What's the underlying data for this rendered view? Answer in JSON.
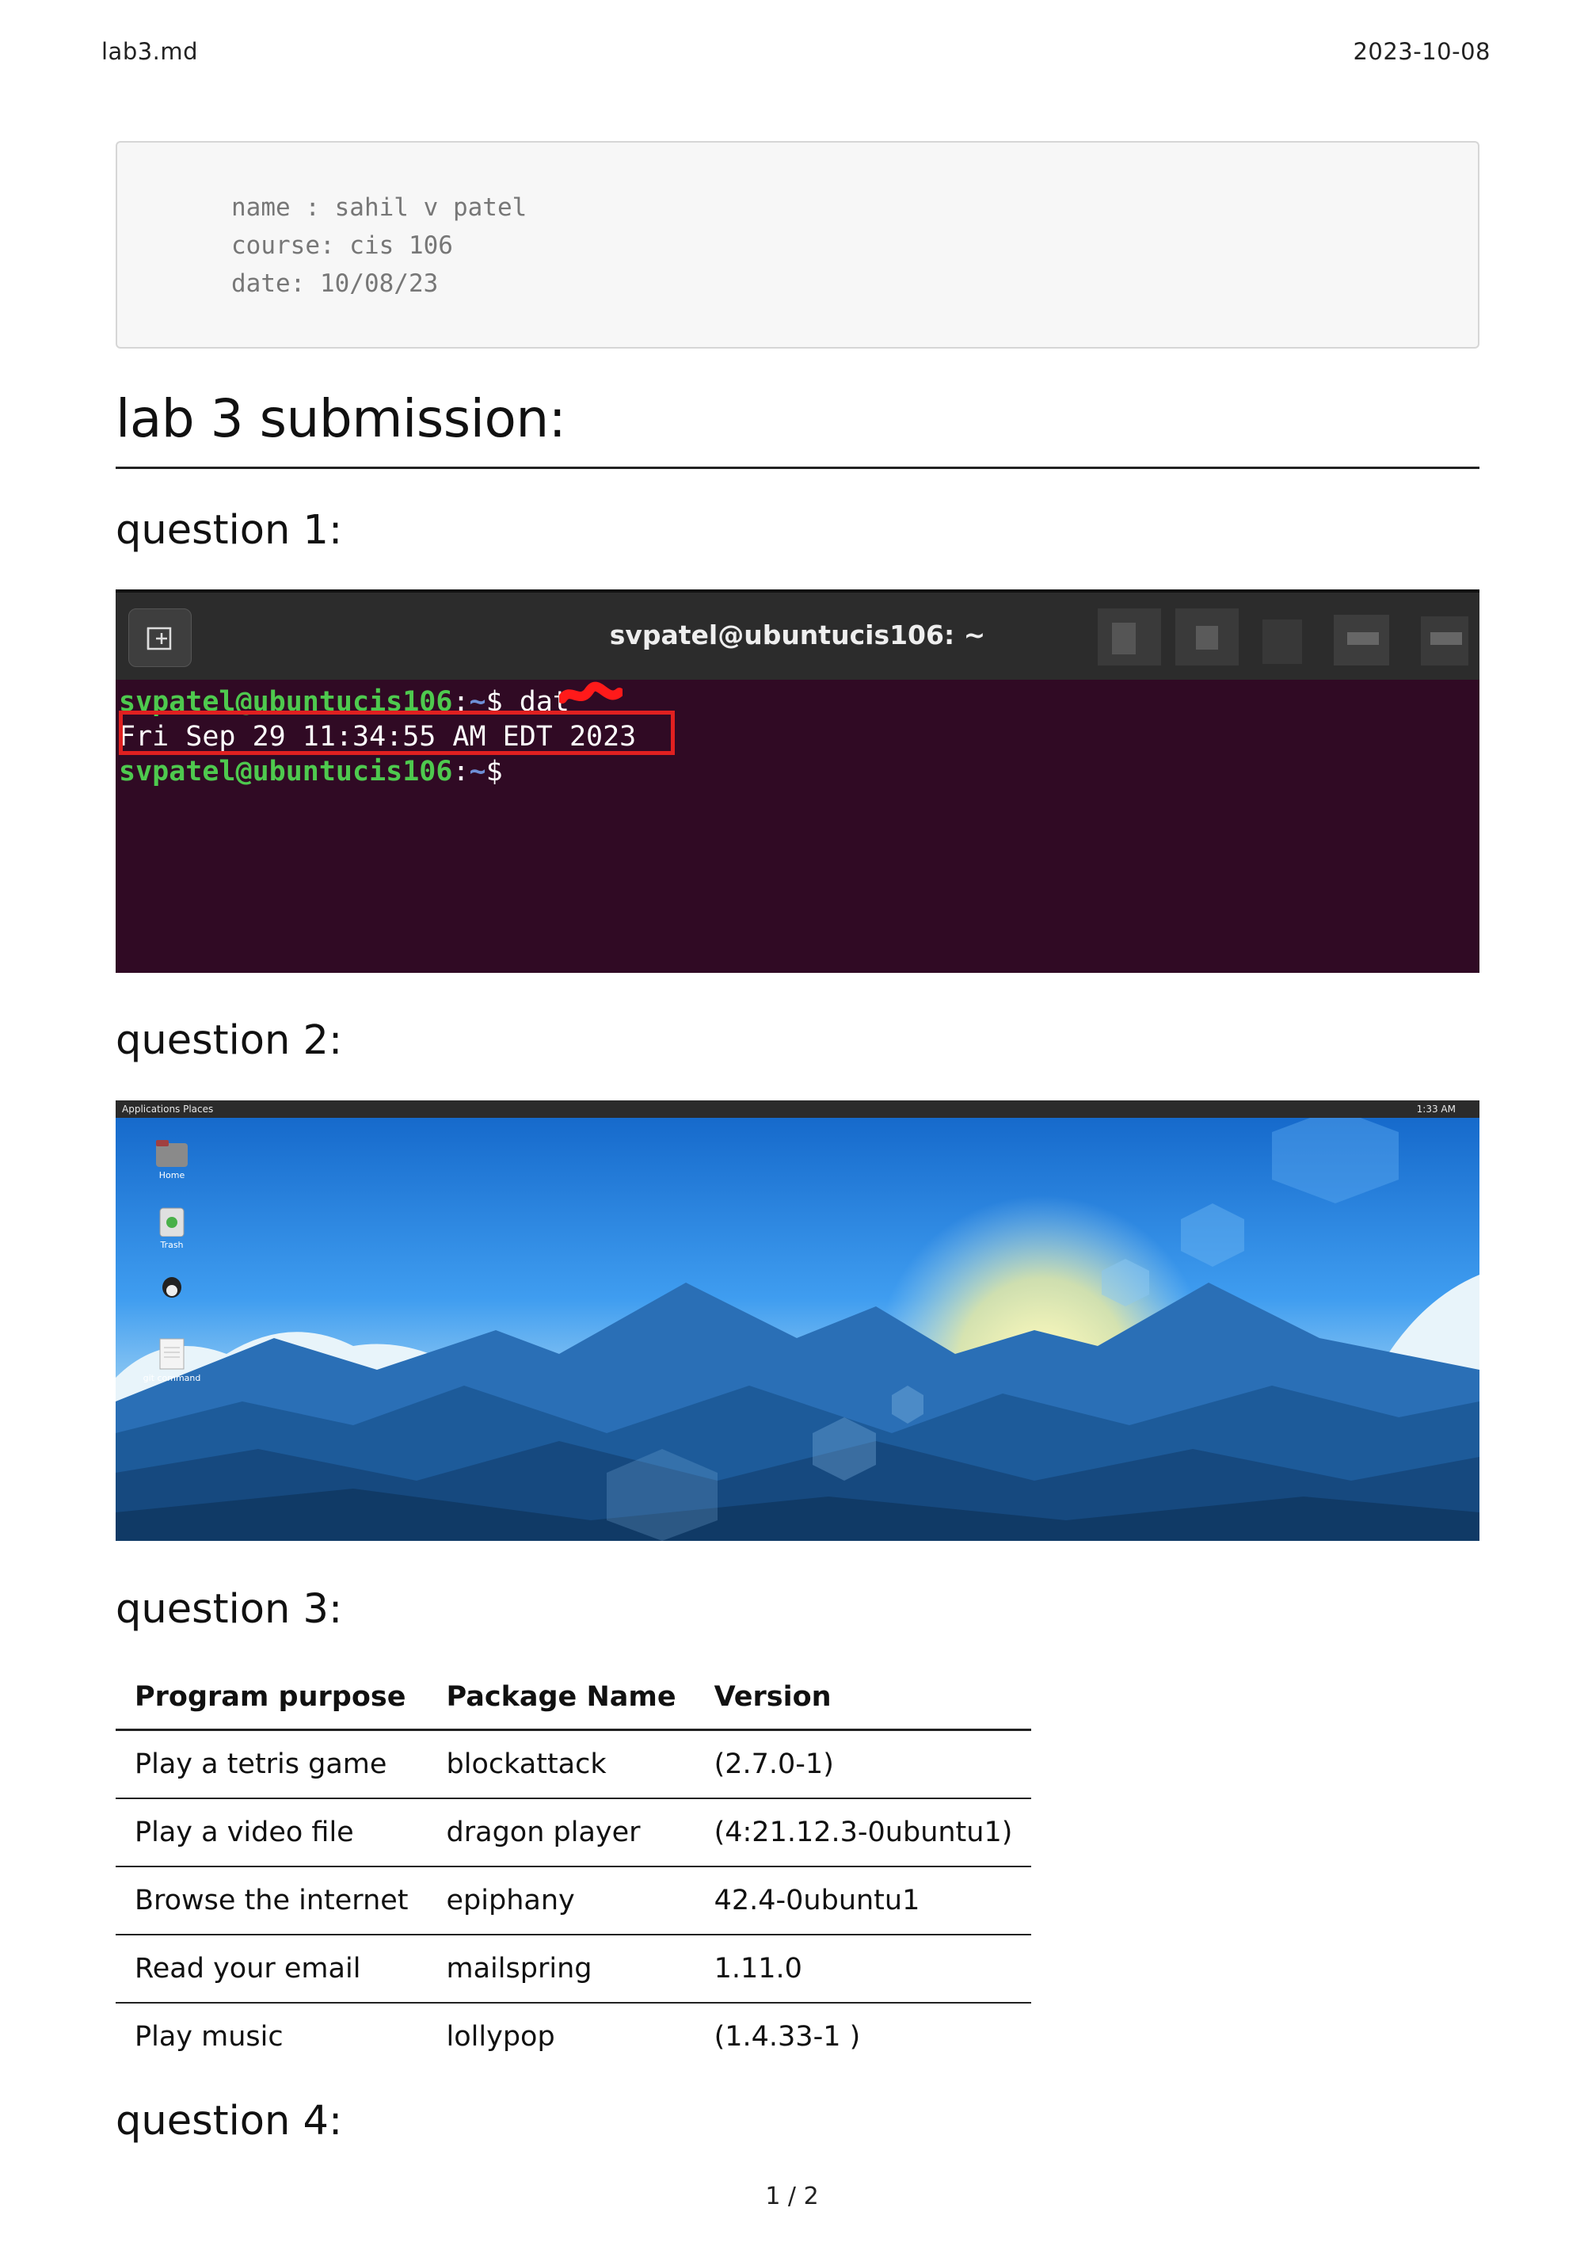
{
  "header": {
    "filename": "lab3.md",
    "date": "2023-10-08"
  },
  "code_block": {
    "lines": [
      "name : sahil v patel",
      "course: cis 106",
      "date: 10/08/23"
    ]
  },
  "title": "lab 3 submission:",
  "sections": {
    "q1": "question 1:",
    "q2": "question 2:",
    "q3": "question 3:",
    "q4": "question 4:"
  },
  "terminal": {
    "window_title": "svpatel@ubuntucis106: ~",
    "prompt_user": "svpatel@ubuntucis106",
    "prompt_sep": ":",
    "prompt_dir": "~",
    "prompt_dollar": "$",
    "command": "dat",
    "output": "Fri Sep 29 11:34:55 AM EDT 2023",
    "highlight_color": "#e02020"
  },
  "desktop": {
    "panel_left": "Applications   Places",
    "panel_time": "1:33 AM",
    "icons": [
      "Home",
      "Trash",
      "",
      "git command"
    ]
  },
  "table": {
    "headers": [
      "Program purpose",
      "Package Name",
      "Version"
    ],
    "rows": [
      [
        "Play a tetris game",
        "blockattack",
        "(2.7.0-1)"
      ],
      [
        "Play a video file",
        "dragon player",
        "(4:21.12.3-0ubuntu1)"
      ],
      [
        "Browse the internet",
        "epiphany",
        "42.4-0ubuntu1"
      ],
      [
        "Read your email",
        "mailspring",
        "1.11.0"
      ],
      [
        "Play music",
        "lollypop",
        "(1.4.33-1 )"
      ]
    ]
  },
  "footer": {
    "page": "1 / 2"
  }
}
